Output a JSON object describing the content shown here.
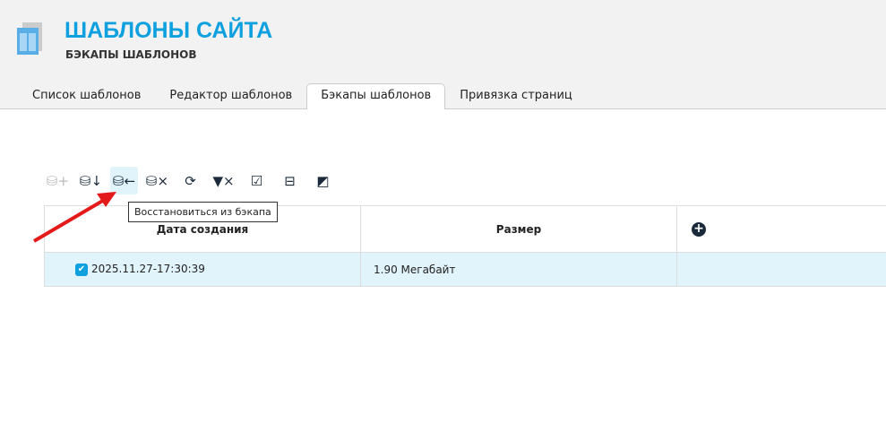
{
  "header": {
    "title": "ШАБЛОНЫ САЙТА",
    "subtitle": "БЭКАПЫ ШАБЛОНОВ"
  },
  "tabs": [
    "Список шаблонов",
    "Редактор шаблонов",
    "Бэкапы шаблонов",
    "Привязка страниц"
  ],
  "tooltip": "Восстановиться из бэкапа",
  "table": {
    "headers": [
      "Дата создания",
      "Размер"
    ],
    "rows": [
      {
        "date": "2025.11.27-17:30:39",
        "size": "1.90 Мегабайт"
      }
    ]
  }
}
